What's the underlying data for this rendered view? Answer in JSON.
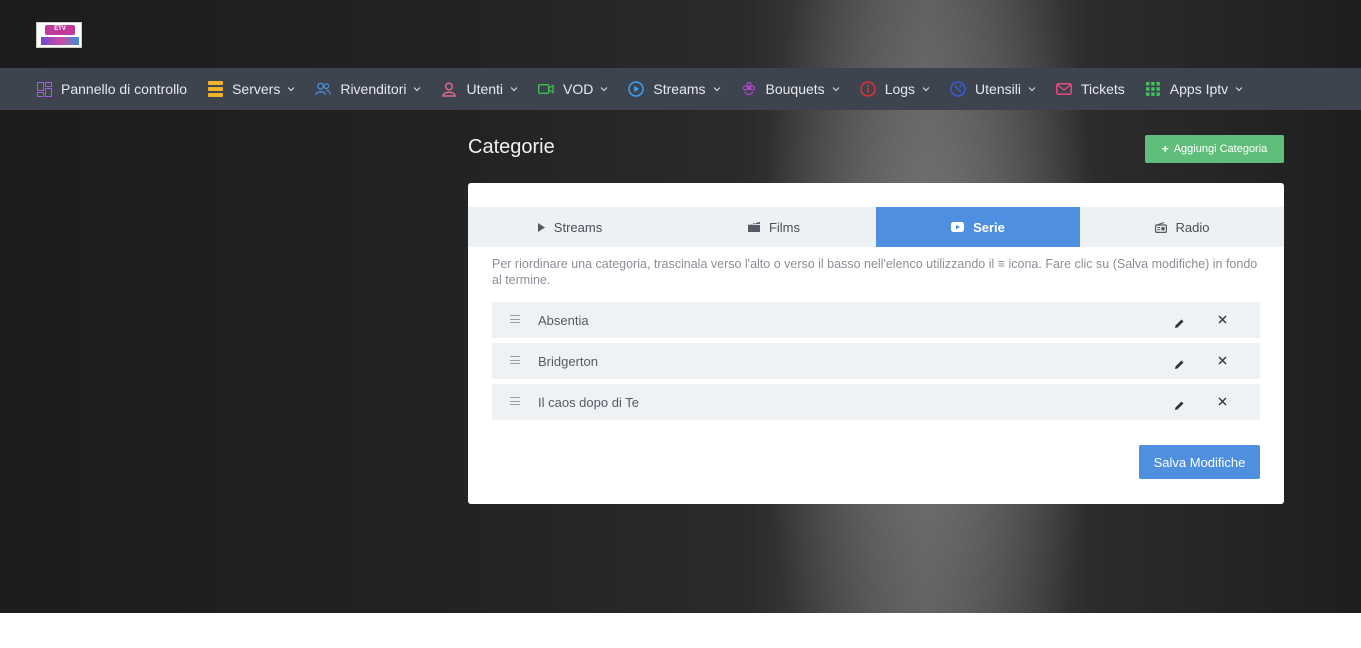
{
  "logo": {
    "text": "ETV"
  },
  "nav": {
    "items": [
      {
        "label": "Pannello di controllo",
        "icon": "dashboard-icon",
        "color": "#a35bd6",
        "dropdown": false
      },
      {
        "label": "Servers",
        "icon": "server-icon",
        "color": "#f0b429",
        "dropdown": true
      },
      {
        "label": "Rivenditori",
        "icon": "users-icon",
        "color": "#4e8fe0",
        "dropdown": true
      },
      {
        "label": "Utenti",
        "icon": "user-icon",
        "color": "#e26a8d",
        "dropdown": true
      },
      {
        "label": "VOD",
        "icon": "video-icon",
        "color": "#3bbf4a",
        "dropdown": true
      },
      {
        "label": "Streams",
        "icon": "play-circle-icon",
        "color": "#3aa0f0",
        "dropdown": true
      },
      {
        "label": "Bouquets",
        "icon": "flower-icon",
        "color": "#b047c9",
        "dropdown": true
      },
      {
        "label": "Logs",
        "icon": "info-icon",
        "color": "#e03131",
        "dropdown": true
      },
      {
        "label": "Utensili",
        "icon": "tools-icon",
        "color": "#3b5bdb",
        "dropdown": true
      },
      {
        "label": "Tickets",
        "icon": "mail-icon",
        "color": "#e64980",
        "dropdown": false
      },
      {
        "label": "Apps Iptv",
        "icon": "grid-icon",
        "color": "#40c057",
        "dropdown": true
      }
    ]
  },
  "page": {
    "title": "Categorie",
    "add_button": "Aggiungi Categoria"
  },
  "tabs": [
    {
      "label": "Streams",
      "icon": "play-icon",
      "active": false
    },
    {
      "label": "Films",
      "icon": "film-icon",
      "active": false
    },
    {
      "label": "Serie",
      "icon": "youtube-icon",
      "active": true
    },
    {
      "label": "Radio",
      "icon": "radio-icon",
      "active": false
    }
  ],
  "hint_text": "Per riordinare una categoria, trascinala verso l'alto o verso il basso nell'elenco utilizzando il ≡ icona. Fare clic su (Salva modifiche) in fondo al termine.",
  "categories": [
    {
      "name": "Absentia"
    },
    {
      "name": "Bridgerton"
    },
    {
      "name": "Il caos dopo di Te"
    }
  ],
  "save_button": "Salva Modifiche",
  "colors": {
    "navbar": "#3d4450",
    "accent": "#4e8fe0",
    "add_button": "#5fbf7a"
  }
}
